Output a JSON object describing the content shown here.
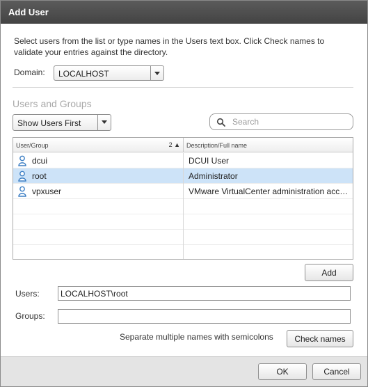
{
  "dialog": {
    "title": "Add User"
  },
  "instructions": "Select users from the list or type names in the Users text box. Click Check names to validate your entries against the directory.",
  "domain": {
    "label": "Domain:",
    "value": "LOCALHOST"
  },
  "users_and_groups": {
    "title": "Users and Groups",
    "filter": {
      "value": "Show Users First"
    },
    "search": {
      "placeholder": "Search",
      "value": ""
    },
    "table": {
      "columns": [
        {
          "label": "User/Group",
          "sort": "2 ▲"
        },
        {
          "label": "Description/Full name"
        }
      ],
      "rows": [
        {
          "name": "dcui",
          "description": "DCUI User",
          "selected": false
        },
        {
          "name": "root",
          "description": "Administrator",
          "selected": true
        },
        {
          "name": "vpxuser",
          "description": "VMware VirtualCenter administration account",
          "selected": false
        }
      ]
    },
    "add_label": "Add"
  },
  "users_field": {
    "label": "Users:",
    "value": "LOCALHOST\\root"
  },
  "groups_field": {
    "label": "Groups:",
    "value": ""
  },
  "hint": "Separate multiple names with semicolons",
  "check_names_label": "Check names",
  "footer": {
    "ok_label": "OK",
    "cancel_label": "Cancel"
  },
  "colors": {
    "titlebar": "#4f4f4f",
    "selected_row": "#cde3f8",
    "user_icon": "#3d7fc4"
  }
}
